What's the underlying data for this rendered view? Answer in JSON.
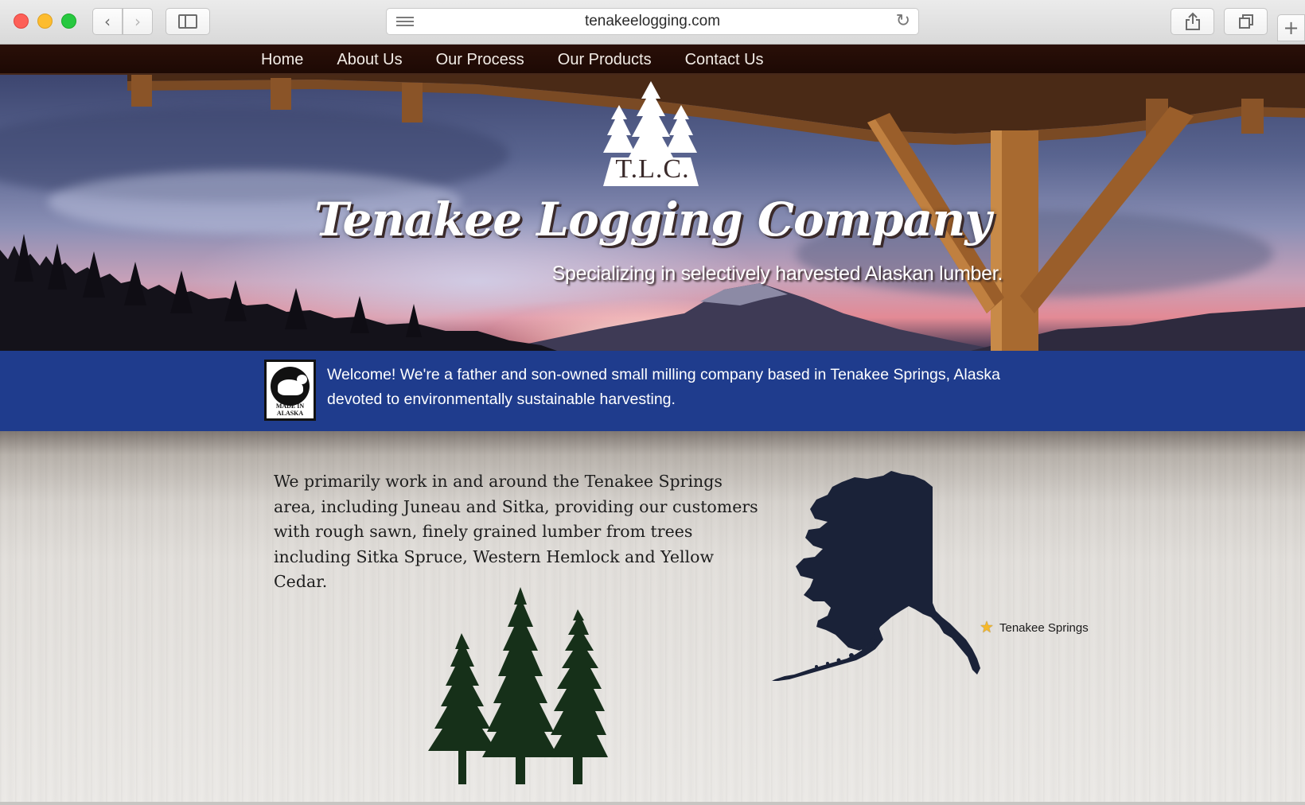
{
  "browser": {
    "url": "tenakeelogging.com",
    "icons": {
      "back": "chevron-left-icon",
      "forward": "chevron-right-icon",
      "sidebar": "sidebar-icon",
      "reader": "reader-view-icon",
      "reload": "reload-icon",
      "share": "share-icon",
      "tabs": "tabs-overview-icon",
      "new_tab": "plus-icon"
    }
  },
  "nav": {
    "items": [
      "Home",
      "About Us",
      "Our Process",
      "Our Products",
      "Contact Us"
    ]
  },
  "hero": {
    "logo_text": "T.L.C.",
    "title": "Tenakee Logging Company",
    "subtitle": "Specializing in selectively harvested Alaskan lumber."
  },
  "welcome": {
    "badge_text": "MADE IN ALASKA",
    "text": "Welcome! We're a father and son-owned small milling company based in Tenakee Springs, Alaska devoted to environmentally sustainable harvesting."
  },
  "main": {
    "paragraph": "We primarily work in and around the Tenakee Springs area, including Juneau and Sitka, providing our customers with rough sawn, finely grained lumber from trees including Sitka Spruce, Western Hemlock and Yellow Cedar.",
    "map_label": "Tenakee Springs"
  },
  "colors": {
    "nav_bg": "#2a0f08",
    "welcome_bg": "#1f3c8d",
    "map_fill": "#1a2238",
    "tree_fill": "#163019",
    "star": "#f5b82a"
  }
}
